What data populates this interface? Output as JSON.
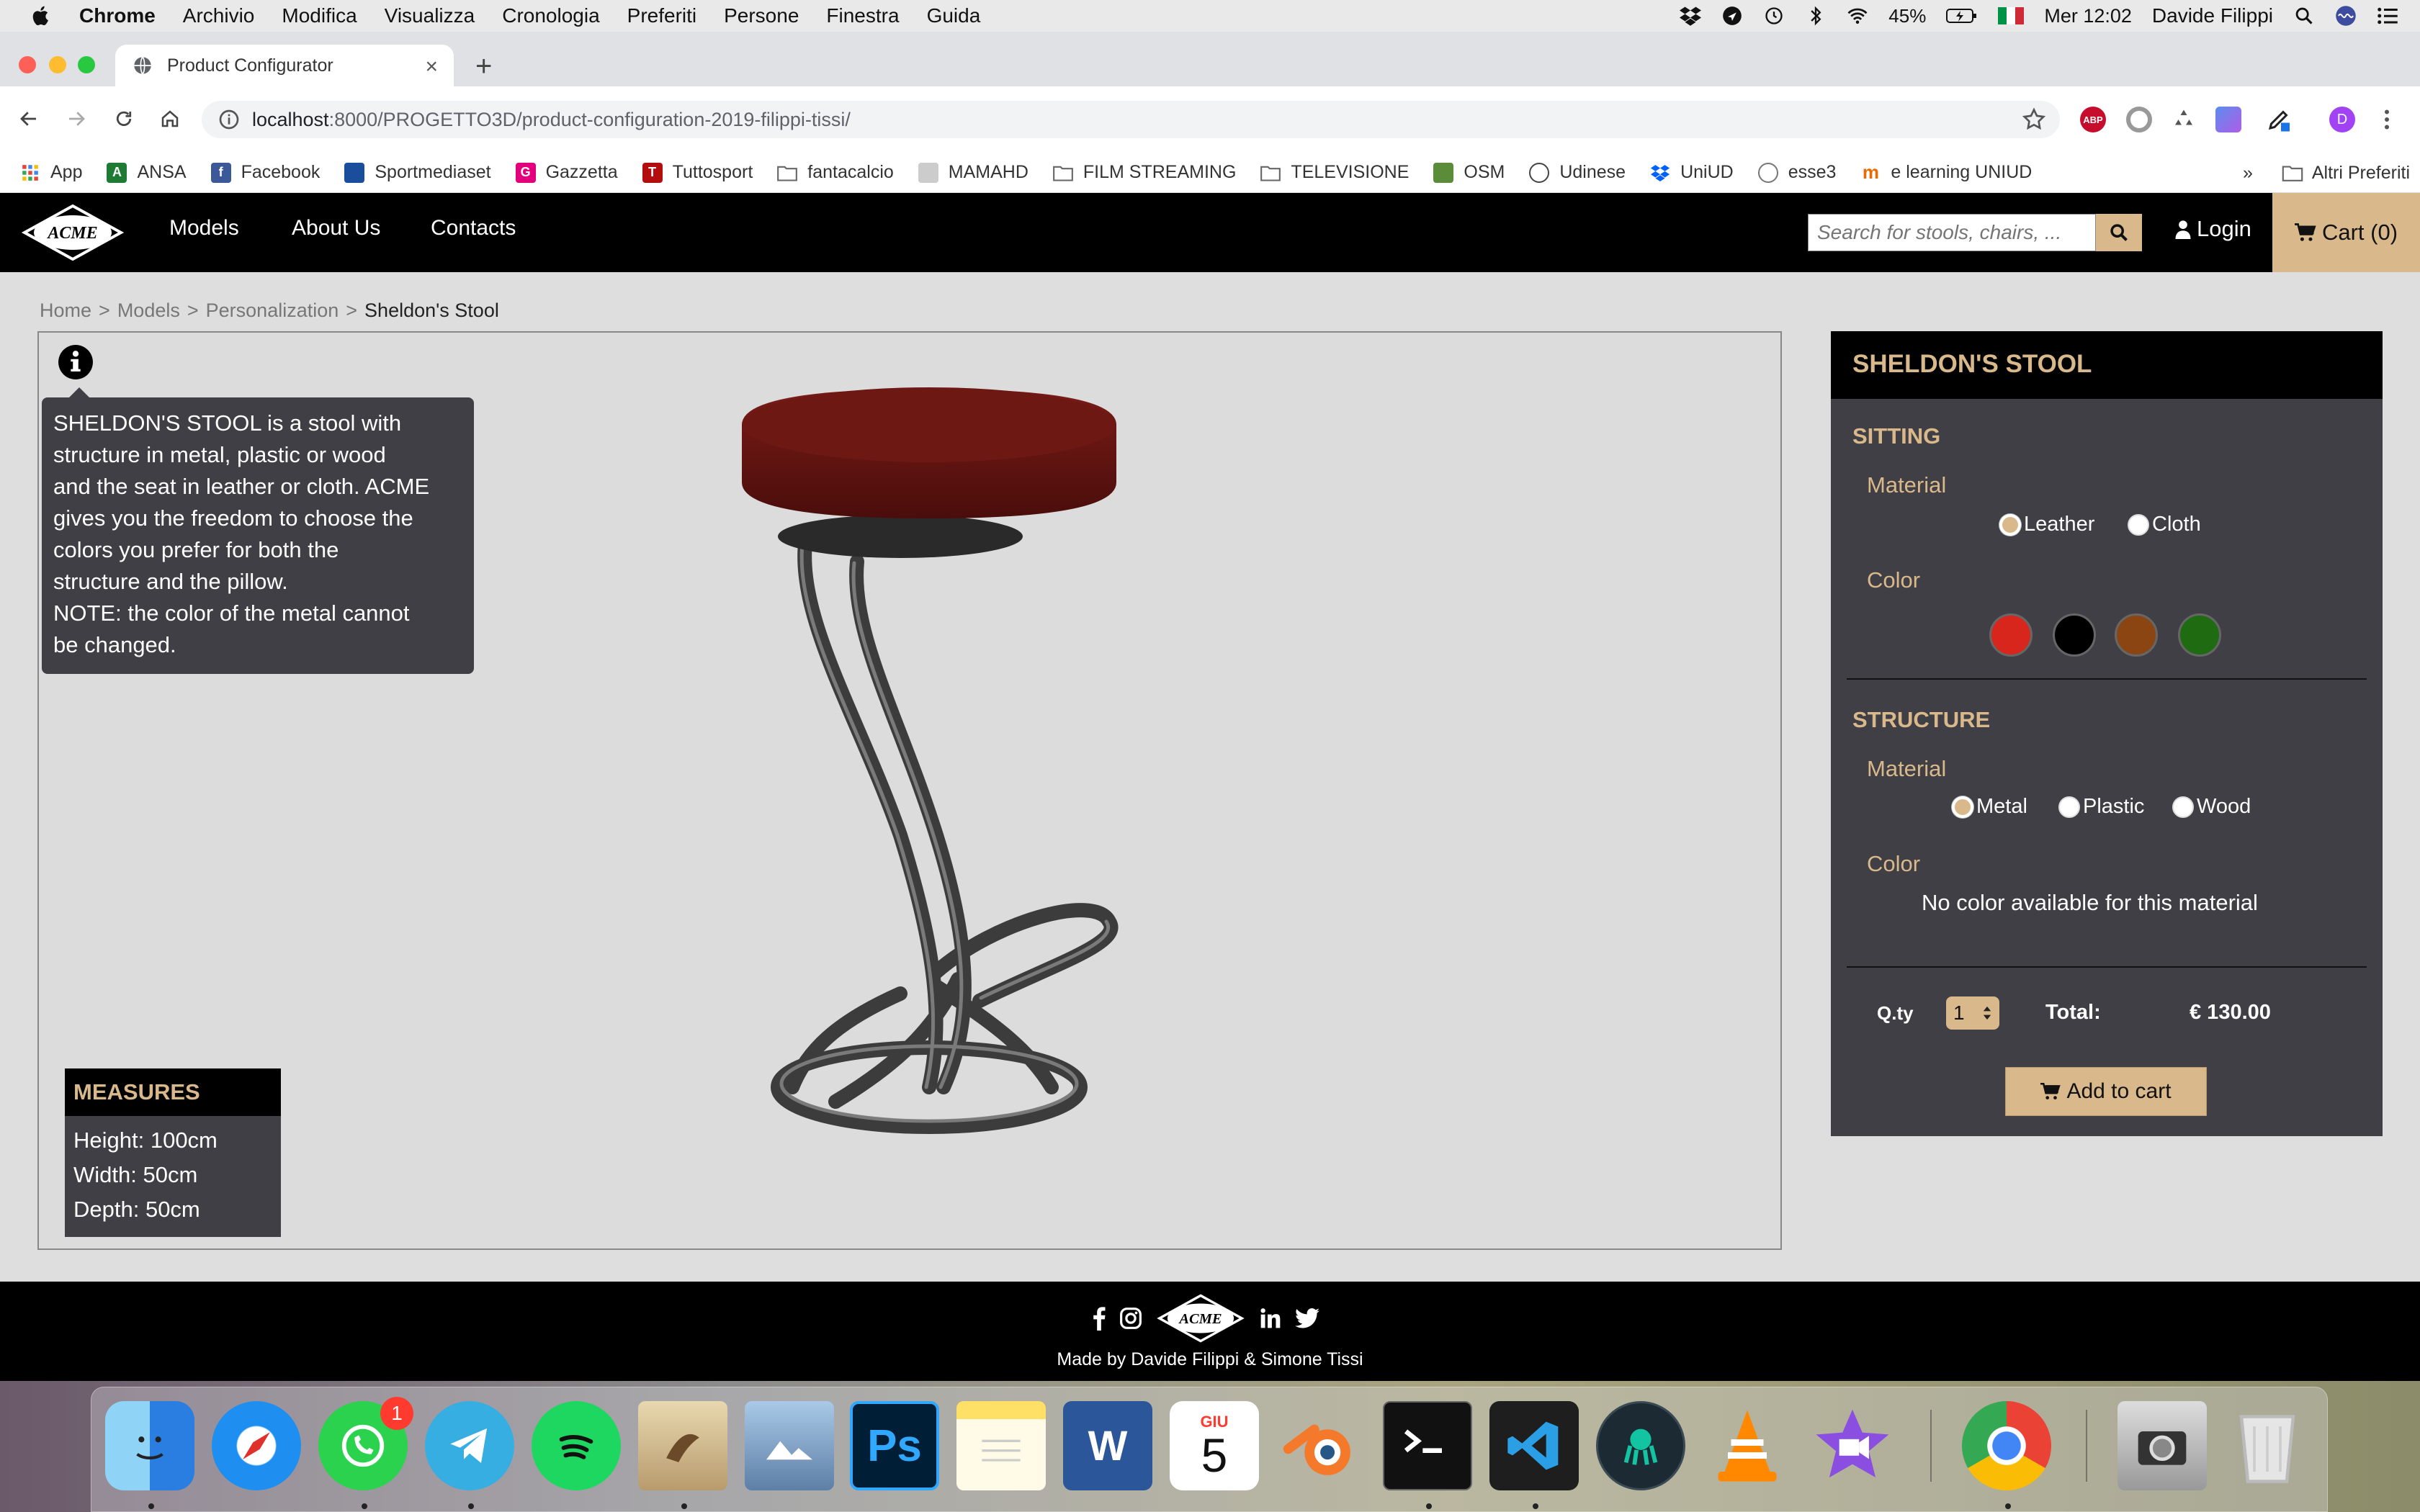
{
  "menubar": {
    "app": "Chrome",
    "items": [
      "Archivio",
      "Modifica",
      "Visualizza",
      "Cronologia",
      "Preferiti",
      "Persone",
      "Finestra",
      "Guida"
    ],
    "battery": "45%",
    "clock": "Mer 12:02",
    "user": "Davide  Filippi"
  },
  "browser": {
    "tab_title": "Product Configurator",
    "url_host": "localhost",
    "url_rest": ":8000/PROGETTO3D/product-configuration-2019-filippi-tissi/",
    "profile_initial": "D"
  },
  "bookmarks": {
    "items": [
      {
        "label": "App",
        "color": "#ea4335"
      },
      {
        "label": "ANSA",
        "color": "#1e7b34"
      },
      {
        "label": "Facebook",
        "color": "#3b5998"
      },
      {
        "label": "Sportmediaset",
        "color": "#1a4d9c"
      },
      {
        "label": "Gazzetta",
        "color": "#e4007c"
      },
      {
        "label": "Tuttosport",
        "color": "#b40d0d"
      },
      {
        "label": "fantacalcio",
        "color": "#777777"
      },
      {
        "label": "MAMAHD",
        "color": "#999999"
      },
      {
        "label": "FILM STREAMING",
        "color": "#777777"
      },
      {
        "label": "TELEVISIONE",
        "color": "#777777"
      },
      {
        "label": "OSM",
        "color": "#5b8c3a"
      },
      {
        "label": "Udinese",
        "color": "#444444"
      },
      {
        "label": "UniUD",
        "color": "#0061fe"
      },
      {
        "label": "esse3",
        "color": "#777777"
      },
      {
        "label": "e learning UNIUD",
        "color": "#e96b00"
      }
    ],
    "overflow": "»",
    "other": "Altri Preferiti"
  },
  "site": {
    "logo_text": "ACME",
    "nav": [
      "Models",
      "About Us",
      "Contacts"
    ],
    "search_placeholder": "Search for stools, chairs, ...",
    "login": "Login",
    "cart": "Cart (0)",
    "accent": "#d9b98b"
  },
  "breadcrumb": {
    "items": [
      "Home",
      "Models",
      "Personalization"
    ],
    "separator": ">",
    "current": "Sheldon's Stool"
  },
  "viewer": {
    "info_lines": [
      "SHELDON'S STOOL is a stool with",
      "structure in metal, plastic or wood",
      "and the seat in leather or cloth. ACME",
      "gives you the freedom to choose the",
      "colors you prefer for both the",
      "structure and the pillow.",
      "NOTE: the color of the metal cannot",
      "be changed."
    ],
    "measures_title": "MEASURES",
    "height": "Height: 100cm",
    "width": "Width: 50cm",
    "depth": "Depth: 50cm"
  },
  "panel": {
    "title": "SHELDON'S STOOL",
    "sitting": {
      "title": "SITTING",
      "material_label": "Material",
      "materials": [
        "Leather",
        "Cloth"
      ],
      "selected_material": "Leather",
      "color_label": "Color",
      "colors": [
        "#d9261c",
        "#000000",
        "#8b4513",
        "#1e6b12"
      ]
    },
    "structure": {
      "title": "STRUCTURE",
      "material_label": "Material",
      "materials": [
        "Metal",
        "Plastic",
        "Wood"
      ],
      "selected_material": "Metal",
      "color_label": "Color",
      "no_color": "No color available for this material"
    },
    "qty_label": "Q.ty",
    "qty_value": "1",
    "total_label": "Total:",
    "total_value": "€ 130.00",
    "add_to_cart": "Add to cart"
  },
  "footer": {
    "logo_text": "ACME",
    "credit": "Made by Davide Filippi & Simone Tissi"
  },
  "dock": {
    "whatsapp_badge": "1",
    "calendar_month": "GIU",
    "calendar_day": "5",
    "photoshop_label": "Ps",
    "word_label": "W"
  }
}
